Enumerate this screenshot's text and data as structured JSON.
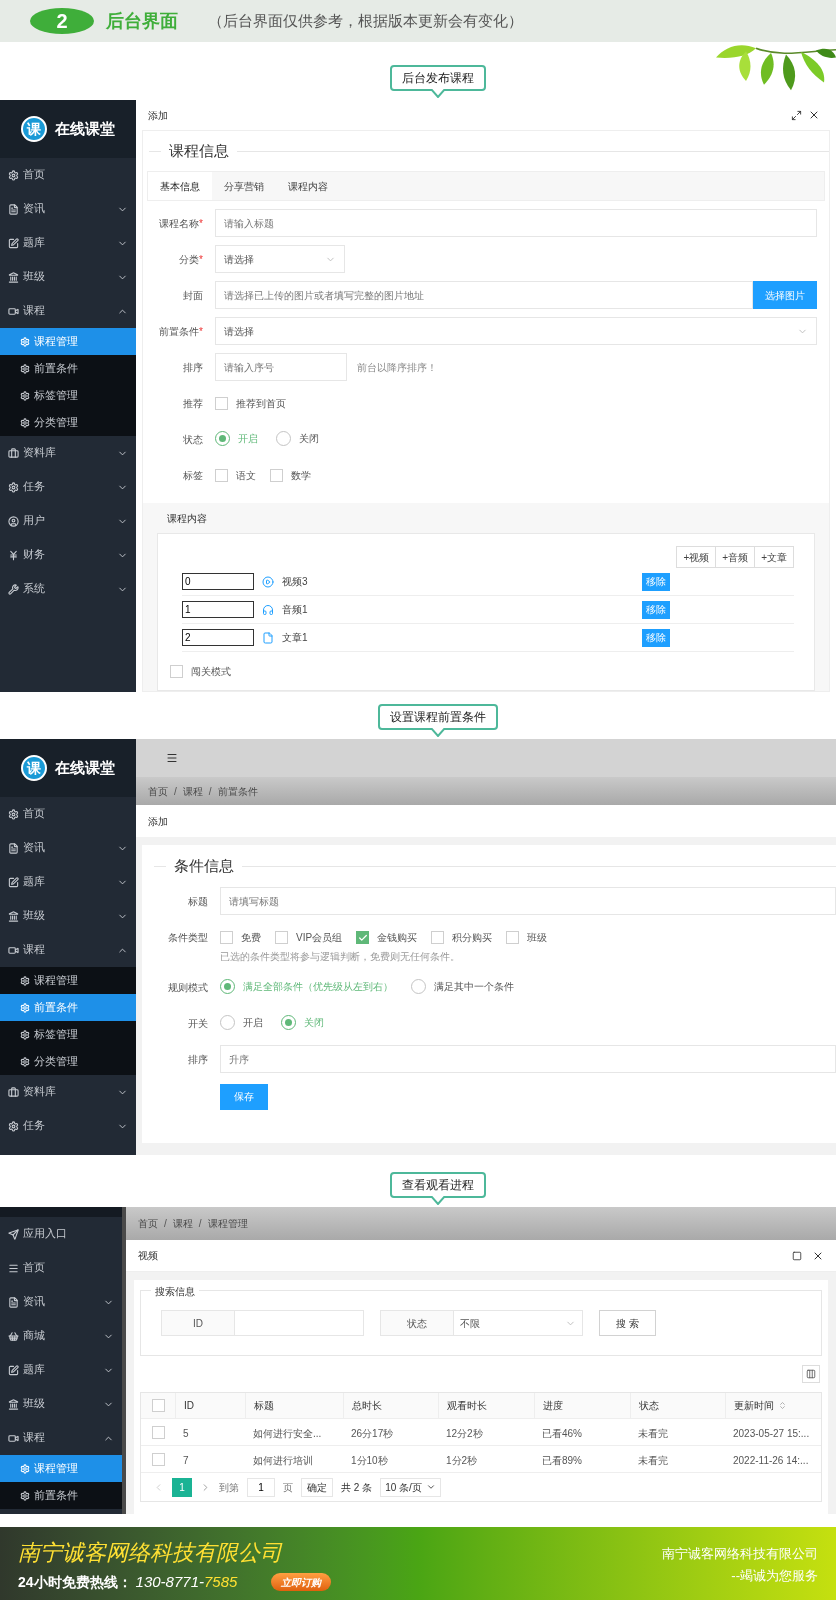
{
  "header": {
    "badge": "2",
    "title": "后台界面",
    "note": "（后台界面仅供参考，根据版本更新会有变化）"
  },
  "publish_course": {
    "callout": "后台发布课程",
    "sidebar": {
      "brand": {
        "logo": "课",
        "name": "在线课堂"
      },
      "items": [
        {
          "label": "首页",
          "selected": false
        },
        {
          "label": "资讯",
          "selected": false,
          "expanded": false
        },
        {
          "label": "题库",
          "selected": false,
          "expanded": false
        },
        {
          "label": "班级",
          "selected": false,
          "expanded": false
        },
        {
          "label": "课程",
          "selected": false,
          "expanded": true,
          "children": [
            {
              "label": "课程管理",
              "selected": true
            },
            {
              "label": "前置条件",
              "selected": false
            },
            {
              "label": "标签管理",
              "selected": false
            },
            {
              "label": "分类管理",
              "selected": false
            }
          ]
        },
        {
          "label": "资料库",
          "selected": false,
          "expanded": false
        },
        {
          "label": "任务",
          "selected": false,
          "expanded": false
        },
        {
          "label": "用户",
          "selected": false,
          "expanded": false
        },
        {
          "label": "财务",
          "selected": false,
          "expanded": false
        },
        {
          "label": "系统",
          "selected": false,
          "expanded": false
        }
      ]
    },
    "window_title": "添加",
    "card_title": "课程信息",
    "tabs": [
      {
        "label": "基本信息",
        "selected": true
      },
      {
        "label": "分享营销",
        "selected": false
      },
      {
        "label": "课程内容",
        "selected": false
      }
    ],
    "fields": [
      {
        "kind": "text",
        "label": "课程名称",
        "required_mark": "*",
        "placeholder": "请输入标题"
      },
      {
        "kind": "select_short",
        "label": "分类",
        "required_mark": "*",
        "placeholder": "请选择"
      },
      {
        "kind": "text_button",
        "label": "封面",
        "placeholder": "请选择已上传的图片或者填写完整的图片地址",
        "button": "选择图片"
      },
      {
        "kind": "select",
        "label": "前置条件",
        "required_mark": "*",
        "placeholder": "请选择"
      },
      {
        "kind": "text_hint",
        "label": "排序",
        "placeholder": "请输入序号",
        "hint": "前台以降序排序！"
      },
      {
        "kind": "checkboxes",
        "label": "推荐",
        "options": [
          {
            "label": "推荐到首页",
            "checked": false
          }
        ]
      },
      {
        "kind": "radios",
        "label": "状态",
        "options": [
          {
            "label": "开启",
            "selected": true
          },
          {
            "label": "关闭",
            "selected": false
          }
        ]
      },
      {
        "kind": "checkboxes",
        "label": "标签",
        "options": [
          {
            "label": "语文",
            "checked": false
          },
          {
            "label": "数学",
            "checked": false
          }
        ]
      }
    ],
    "content": {
      "title": "课程内容",
      "add_buttons": [
        "+视频",
        "+音频",
        "+文章"
      ],
      "items": [
        {
          "kind": "video",
          "order": "0",
          "title": "视频3",
          "action": "移除"
        },
        {
          "kind": "audio",
          "order": "1",
          "title": "音频1",
          "action": "移除"
        },
        {
          "kind": "article",
          "order": "2",
          "title": "文章1",
          "action": "移除"
        }
      ],
      "gate_mode": {
        "label": "闯关模式",
        "checked": false
      }
    }
  },
  "prerequisite": {
    "callout": "设置课程前置条件",
    "sidebar": {
      "brand": {
        "logo": "课",
        "name": "在线课堂"
      },
      "items": [
        {
          "label": "首页",
          "selected": false
        },
        {
          "label": "资讯",
          "selected": false,
          "expanded": false
        },
        {
          "label": "题库",
          "selected": false,
          "expanded": false
        },
        {
          "label": "班级",
          "selected": false,
          "expanded": false
        },
        {
          "label": "课程",
          "selected": false,
          "expanded": true,
          "children": [
            {
              "label": "课程管理",
              "selected": false
            },
            {
              "label": "前置条件",
              "selected": true
            },
            {
              "label": "标签管理",
              "selected": false
            },
            {
              "label": "分类管理",
              "selected": false
            }
          ]
        },
        {
          "label": "资料库",
          "selected": false,
          "expanded": false
        },
        {
          "label": "任务",
          "selected": false,
          "expanded": false
        }
      ]
    },
    "breadcrumb": {
      "separator": "/",
      "items": [
        "首页",
        "课程",
        "前置条件"
      ]
    },
    "window_title": "添加",
    "card_title": "条件信息",
    "fields": [
      {
        "kind": "text",
        "label": "标题",
        "placeholder": "请填写标题"
      },
      {
        "kind": "checkboxes",
        "label": "条件类型",
        "options": [
          {
            "label": "免费",
            "checked": false
          },
          {
            "label": "VIP会员组",
            "checked": false
          },
          {
            "label": "金钱购买",
            "checked": true
          },
          {
            "label": "积分购买",
            "checked": false
          },
          {
            "label": "班级",
            "checked": false
          }
        ],
        "hint": "已选的条件类型将参与逻辑判断，免费则无任何条件。"
      },
      {
        "kind": "radios",
        "label": "规则模式",
        "options": [
          {
            "label": "满足全部条件（优先级从左到右）",
            "selected": true
          },
          {
            "label": "满足其中一个条件",
            "selected": false
          }
        ]
      },
      {
        "kind": "radios",
        "label": "开关",
        "options": [
          {
            "label": "开启",
            "selected": false
          },
          {
            "label": "关闭",
            "selected": true
          }
        ]
      },
      {
        "kind": "text",
        "label": "排序",
        "placeholder": "升序"
      }
    ],
    "save_button": "保存"
  },
  "progress": {
    "callout": "查看观看进程",
    "sidebar": {
      "items": [
        {
          "label": "应用入口",
          "selected": false
        },
        {
          "label": "首页",
          "selected": false
        },
        {
          "label": "资讯",
          "selected": false,
          "expanded": false
        },
        {
          "label": "商城",
          "selected": false,
          "expanded": false
        },
        {
          "label": "题库",
          "selected": false,
          "expanded": false
        },
        {
          "label": "班级",
          "selected": false,
          "expanded": false
        },
        {
          "label": "课程",
          "selected": false,
          "expanded": true,
          "children": [
            {
              "label": "课程管理",
              "selected": true
            },
            {
              "label": "前置条件",
              "selected": false
            }
          ]
        }
      ]
    },
    "breadcrumb": {
      "separator": "/",
      "items": [
        "首页",
        "课程",
        "课程管理"
      ]
    },
    "modal_title": "视频",
    "search": {
      "legend": "搜索信息",
      "id_label": "ID",
      "status_label": "状态",
      "status_value": "不限",
      "button": "搜 索"
    },
    "table": {
      "all_checked": false,
      "columns": [
        "ID",
        "标题",
        "总时长",
        "观看时长",
        "进度",
        "状态",
        "更新时间"
      ],
      "rows": [
        {
          "checked": false,
          "cells": [
            "5",
            "如何进行安全...",
            "26分17秒",
            "12分2秒",
            "已看46%",
            "未看完",
            "2023-05-27 15:..."
          ]
        },
        {
          "checked": false,
          "cells": [
            "7",
            "如何进行培训",
            "1分10秒",
            "1分2秒",
            "已看89%",
            "未看完",
            "2022-11-26 14:..."
          ]
        }
      ]
    },
    "pagination": {
      "current": "1",
      "goto_label": "到第",
      "goto_value": "1",
      "page_label": "页",
      "confirm": "确定",
      "total": "共 2 条",
      "page_size": "10 条/页"
    }
  },
  "footer": {
    "company": "南宁诚客网络科技有限公司",
    "hotline_label": "24小时免费热线：",
    "hotline_prefix": "130-8771-",
    "hotline_suffix": "7585",
    "order_button": "立即订购",
    "company_right": "南宁诚客网络科技有限公司",
    "slogan": "--竭诚为您服务"
  }
}
